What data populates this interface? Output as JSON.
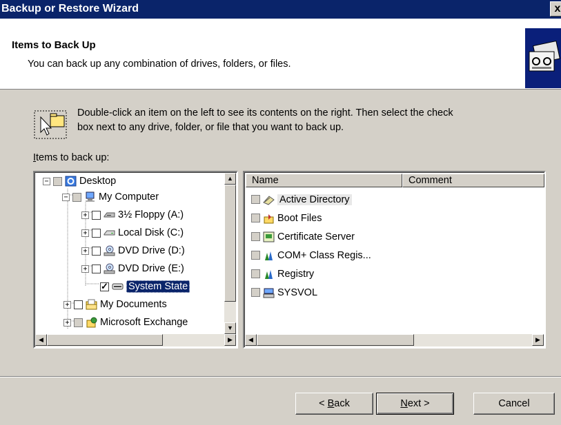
{
  "window": {
    "title": "Backup or Restore Wizard",
    "close_label": "x"
  },
  "header": {
    "title": "Items to Back Up",
    "subtitle": "You can back up any combination of drives, folders, or files."
  },
  "hint": {
    "line1": "Double-click an item on the left to see its contents on the right. Then select the check",
    "line2": "box next to any drive, folder, or file that you want to back up."
  },
  "items_label": {
    "accel": "I",
    "rest": "tems to back up:"
  },
  "tree": {
    "items": [
      {
        "label": "Desktop",
        "icon": "desktop-icon",
        "checkbox": "grey",
        "expander": "-"
      },
      {
        "label": "My Computer",
        "icon": "computer-icon",
        "checkbox": "grey",
        "expander": "-"
      },
      {
        "label": "3½ Floppy (A:)",
        "icon": "floppy-drive-icon",
        "checkbox": "empty",
        "expander": "+"
      },
      {
        "label": "Local Disk (C:)",
        "icon": "hard-disk-icon",
        "checkbox": "empty",
        "expander": "+"
      },
      {
        "label": "DVD Drive (D:)",
        "icon": "dvd-drive-icon",
        "checkbox": "empty",
        "expander": "+"
      },
      {
        "label": "DVD Drive (E:)",
        "icon": "dvd-drive-icon",
        "checkbox": "empty",
        "expander": "+"
      },
      {
        "label": "System State",
        "icon": "system-state-icon",
        "checkbox": "checked",
        "expander": "",
        "selected": true
      },
      {
        "label": "My Documents",
        "icon": "folder-icon",
        "checkbox": "empty",
        "expander": "+"
      },
      {
        "label": "Microsoft Exchange",
        "icon": "exchange-icon",
        "checkbox": "grey",
        "expander": "+"
      }
    ]
  },
  "list": {
    "columns": [
      "Name",
      "Comment"
    ],
    "rows": [
      {
        "name": "Active Directory",
        "icon": "active-directory-icon"
      },
      {
        "name": "Boot Files",
        "icon": "boot-files-icon"
      },
      {
        "name": "Certificate Server",
        "icon": "certificate-icon"
      },
      {
        "name": "COM+ Class Regis...",
        "icon": "com-plus-icon"
      },
      {
        "name": "Registry",
        "icon": "registry-icon"
      },
      {
        "name": "SYSVOL",
        "icon": "sysvol-icon"
      }
    ]
  },
  "buttons": {
    "back_accel": "B",
    "back_rest": "ack",
    "next_accel": "N",
    "next_rest": "ext >",
    "cancel": "Cancel"
  }
}
